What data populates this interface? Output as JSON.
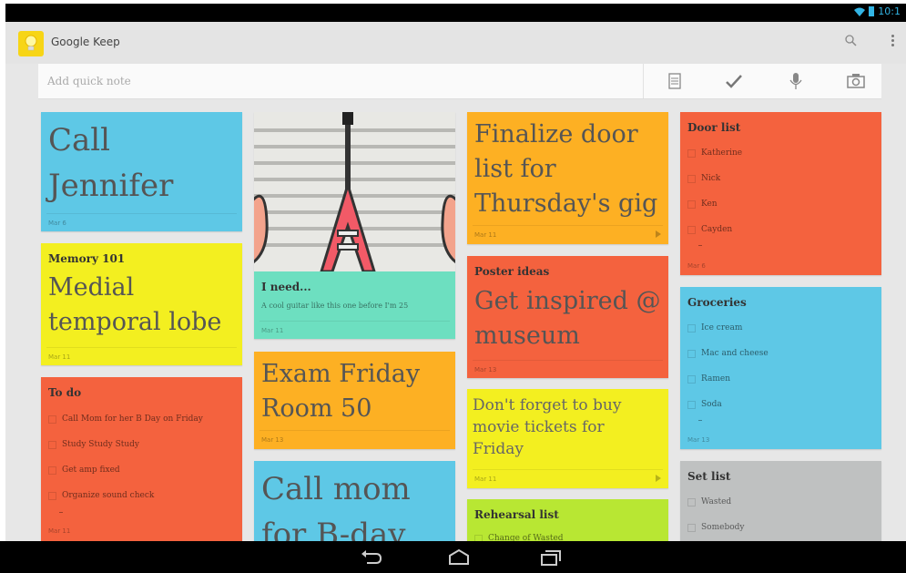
{
  "status_bar": {
    "time": "10:1"
  },
  "app": {
    "title": "Google Keep"
  },
  "quick_note": {
    "placeholder": "Add quick note"
  },
  "notes": {
    "call_jennifer": {
      "text": "Call\nJennifer",
      "date": "Mar 6"
    },
    "memory": {
      "title": "Memory 101",
      "body": "Medial temporal lobe",
      "date": "Mar 11"
    },
    "todo": {
      "title": "To do",
      "items": [
        "Call Mom for her B Day on Friday",
        "Study Study Study",
        "Get amp fixed",
        "Organize sound check"
      ],
      "date": "Mar 11"
    },
    "guitar": {
      "title": "I need...",
      "body": "A cool guitar like this one before I'm 25",
      "date": "Mar 11"
    },
    "exam": {
      "text": "Exam Friday Room 50",
      "date": "Mar 13"
    },
    "call_mom": {
      "text": "Call mom for B-day"
    },
    "finalize": {
      "text": "Finalize door list for Thursday's gig",
      "date": "Mar 11"
    },
    "poster": {
      "title": "Poster ideas",
      "body": "Get inspired @ museum",
      "date": "Mar 13"
    },
    "movie": {
      "text": "Don't forget to buy movie tickets for Friday",
      "date": "Mar 11"
    },
    "rehearsal": {
      "title": "Rehearsal list",
      "first_item": "Change of Wasted"
    },
    "door_list": {
      "title": "Door list",
      "items": [
        "Katherine",
        "Nick",
        "Ken",
        "Cayden"
      ],
      "date": "Mar 6"
    },
    "groceries": {
      "title": "Groceries",
      "items": [
        "Ice cream",
        "Mac and cheese",
        "Ramen",
        "Soda"
      ],
      "date": "Mar 13"
    },
    "set_list": {
      "title": "Set list",
      "items": [
        "Wasted",
        "Somebody"
      ]
    }
  },
  "colors": {
    "blue": "#5ec8e6",
    "yellow": "#f3ef20",
    "red": "#f4623e",
    "teal": "#6ddfc0",
    "orange": "#fdb023",
    "green": "#b8e733",
    "gray": "#bfc1c1"
  },
  "icons": {
    "logo": "lightbulb-icon",
    "search": "search-icon",
    "overflow": "overflow-menu-icon",
    "list": "list-icon",
    "check": "checkmark-icon",
    "mic": "microphone-icon",
    "camera": "camera-icon",
    "back": "back-icon",
    "home": "home-icon",
    "recents": "recents-icon"
  }
}
